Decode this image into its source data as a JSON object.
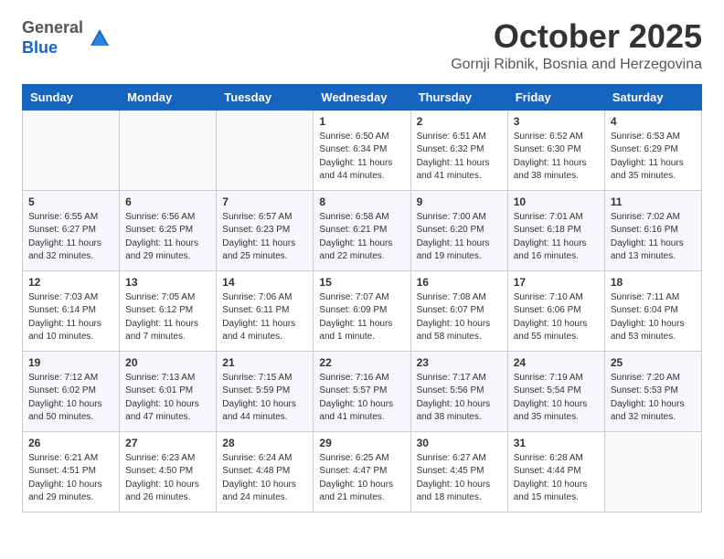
{
  "header": {
    "logo_line1": "General",
    "logo_line2": "Blue",
    "month": "October 2025",
    "location": "Gornji Ribnik, Bosnia and Herzegovina"
  },
  "days_of_week": [
    "Sunday",
    "Monday",
    "Tuesday",
    "Wednesday",
    "Thursday",
    "Friday",
    "Saturday"
  ],
  "weeks": [
    [
      {
        "day": "",
        "info": ""
      },
      {
        "day": "",
        "info": ""
      },
      {
        "day": "",
        "info": ""
      },
      {
        "day": "1",
        "info": "Sunrise: 6:50 AM\nSunset: 6:34 PM\nDaylight: 11 hours\nand 44 minutes."
      },
      {
        "day": "2",
        "info": "Sunrise: 6:51 AM\nSunset: 6:32 PM\nDaylight: 11 hours\nand 41 minutes."
      },
      {
        "day": "3",
        "info": "Sunrise: 6:52 AM\nSunset: 6:30 PM\nDaylight: 11 hours\nand 38 minutes."
      },
      {
        "day": "4",
        "info": "Sunrise: 6:53 AM\nSunset: 6:29 PM\nDaylight: 11 hours\nand 35 minutes."
      }
    ],
    [
      {
        "day": "5",
        "info": "Sunrise: 6:55 AM\nSunset: 6:27 PM\nDaylight: 11 hours\nand 32 minutes."
      },
      {
        "day": "6",
        "info": "Sunrise: 6:56 AM\nSunset: 6:25 PM\nDaylight: 11 hours\nand 29 minutes."
      },
      {
        "day": "7",
        "info": "Sunrise: 6:57 AM\nSunset: 6:23 PM\nDaylight: 11 hours\nand 25 minutes."
      },
      {
        "day": "8",
        "info": "Sunrise: 6:58 AM\nSunset: 6:21 PM\nDaylight: 11 hours\nand 22 minutes."
      },
      {
        "day": "9",
        "info": "Sunrise: 7:00 AM\nSunset: 6:20 PM\nDaylight: 11 hours\nand 19 minutes."
      },
      {
        "day": "10",
        "info": "Sunrise: 7:01 AM\nSunset: 6:18 PM\nDaylight: 11 hours\nand 16 minutes."
      },
      {
        "day": "11",
        "info": "Sunrise: 7:02 AM\nSunset: 6:16 PM\nDaylight: 11 hours\nand 13 minutes."
      }
    ],
    [
      {
        "day": "12",
        "info": "Sunrise: 7:03 AM\nSunset: 6:14 PM\nDaylight: 11 hours\nand 10 minutes."
      },
      {
        "day": "13",
        "info": "Sunrise: 7:05 AM\nSunset: 6:12 PM\nDaylight: 11 hours\nand 7 minutes."
      },
      {
        "day": "14",
        "info": "Sunrise: 7:06 AM\nSunset: 6:11 PM\nDaylight: 11 hours\nand 4 minutes."
      },
      {
        "day": "15",
        "info": "Sunrise: 7:07 AM\nSunset: 6:09 PM\nDaylight: 11 hours\nand 1 minute."
      },
      {
        "day": "16",
        "info": "Sunrise: 7:08 AM\nSunset: 6:07 PM\nDaylight: 10 hours\nand 58 minutes."
      },
      {
        "day": "17",
        "info": "Sunrise: 7:10 AM\nSunset: 6:06 PM\nDaylight: 10 hours\nand 55 minutes."
      },
      {
        "day": "18",
        "info": "Sunrise: 7:11 AM\nSunset: 6:04 PM\nDaylight: 10 hours\nand 53 minutes."
      }
    ],
    [
      {
        "day": "19",
        "info": "Sunrise: 7:12 AM\nSunset: 6:02 PM\nDaylight: 10 hours\nand 50 minutes."
      },
      {
        "day": "20",
        "info": "Sunrise: 7:13 AM\nSunset: 6:01 PM\nDaylight: 10 hours\nand 47 minutes."
      },
      {
        "day": "21",
        "info": "Sunrise: 7:15 AM\nSunset: 5:59 PM\nDaylight: 10 hours\nand 44 minutes."
      },
      {
        "day": "22",
        "info": "Sunrise: 7:16 AM\nSunset: 5:57 PM\nDaylight: 10 hours\nand 41 minutes."
      },
      {
        "day": "23",
        "info": "Sunrise: 7:17 AM\nSunset: 5:56 PM\nDaylight: 10 hours\nand 38 minutes."
      },
      {
        "day": "24",
        "info": "Sunrise: 7:19 AM\nSunset: 5:54 PM\nDaylight: 10 hours\nand 35 minutes."
      },
      {
        "day": "25",
        "info": "Sunrise: 7:20 AM\nSunset: 5:53 PM\nDaylight: 10 hours\nand 32 minutes."
      }
    ],
    [
      {
        "day": "26",
        "info": "Sunrise: 6:21 AM\nSunset: 4:51 PM\nDaylight: 10 hours\nand 29 minutes."
      },
      {
        "day": "27",
        "info": "Sunrise: 6:23 AM\nSunset: 4:50 PM\nDaylight: 10 hours\nand 26 minutes."
      },
      {
        "day": "28",
        "info": "Sunrise: 6:24 AM\nSunset: 4:48 PM\nDaylight: 10 hours\nand 24 minutes."
      },
      {
        "day": "29",
        "info": "Sunrise: 6:25 AM\nSunset: 4:47 PM\nDaylight: 10 hours\nand 21 minutes."
      },
      {
        "day": "30",
        "info": "Sunrise: 6:27 AM\nSunset: 4:45 PM\nDaylight: 10 hours\nand 18 minutes."
      },
      {
        "day": "31",
        "info": "Sunrise: 6:28 AM\nSunset: 4:44 PM\nDaylight: 10 hours\nand 15 minutes."
      },
      {
        "day": "",
        "info": ""
      }
    ]
  ]
}
